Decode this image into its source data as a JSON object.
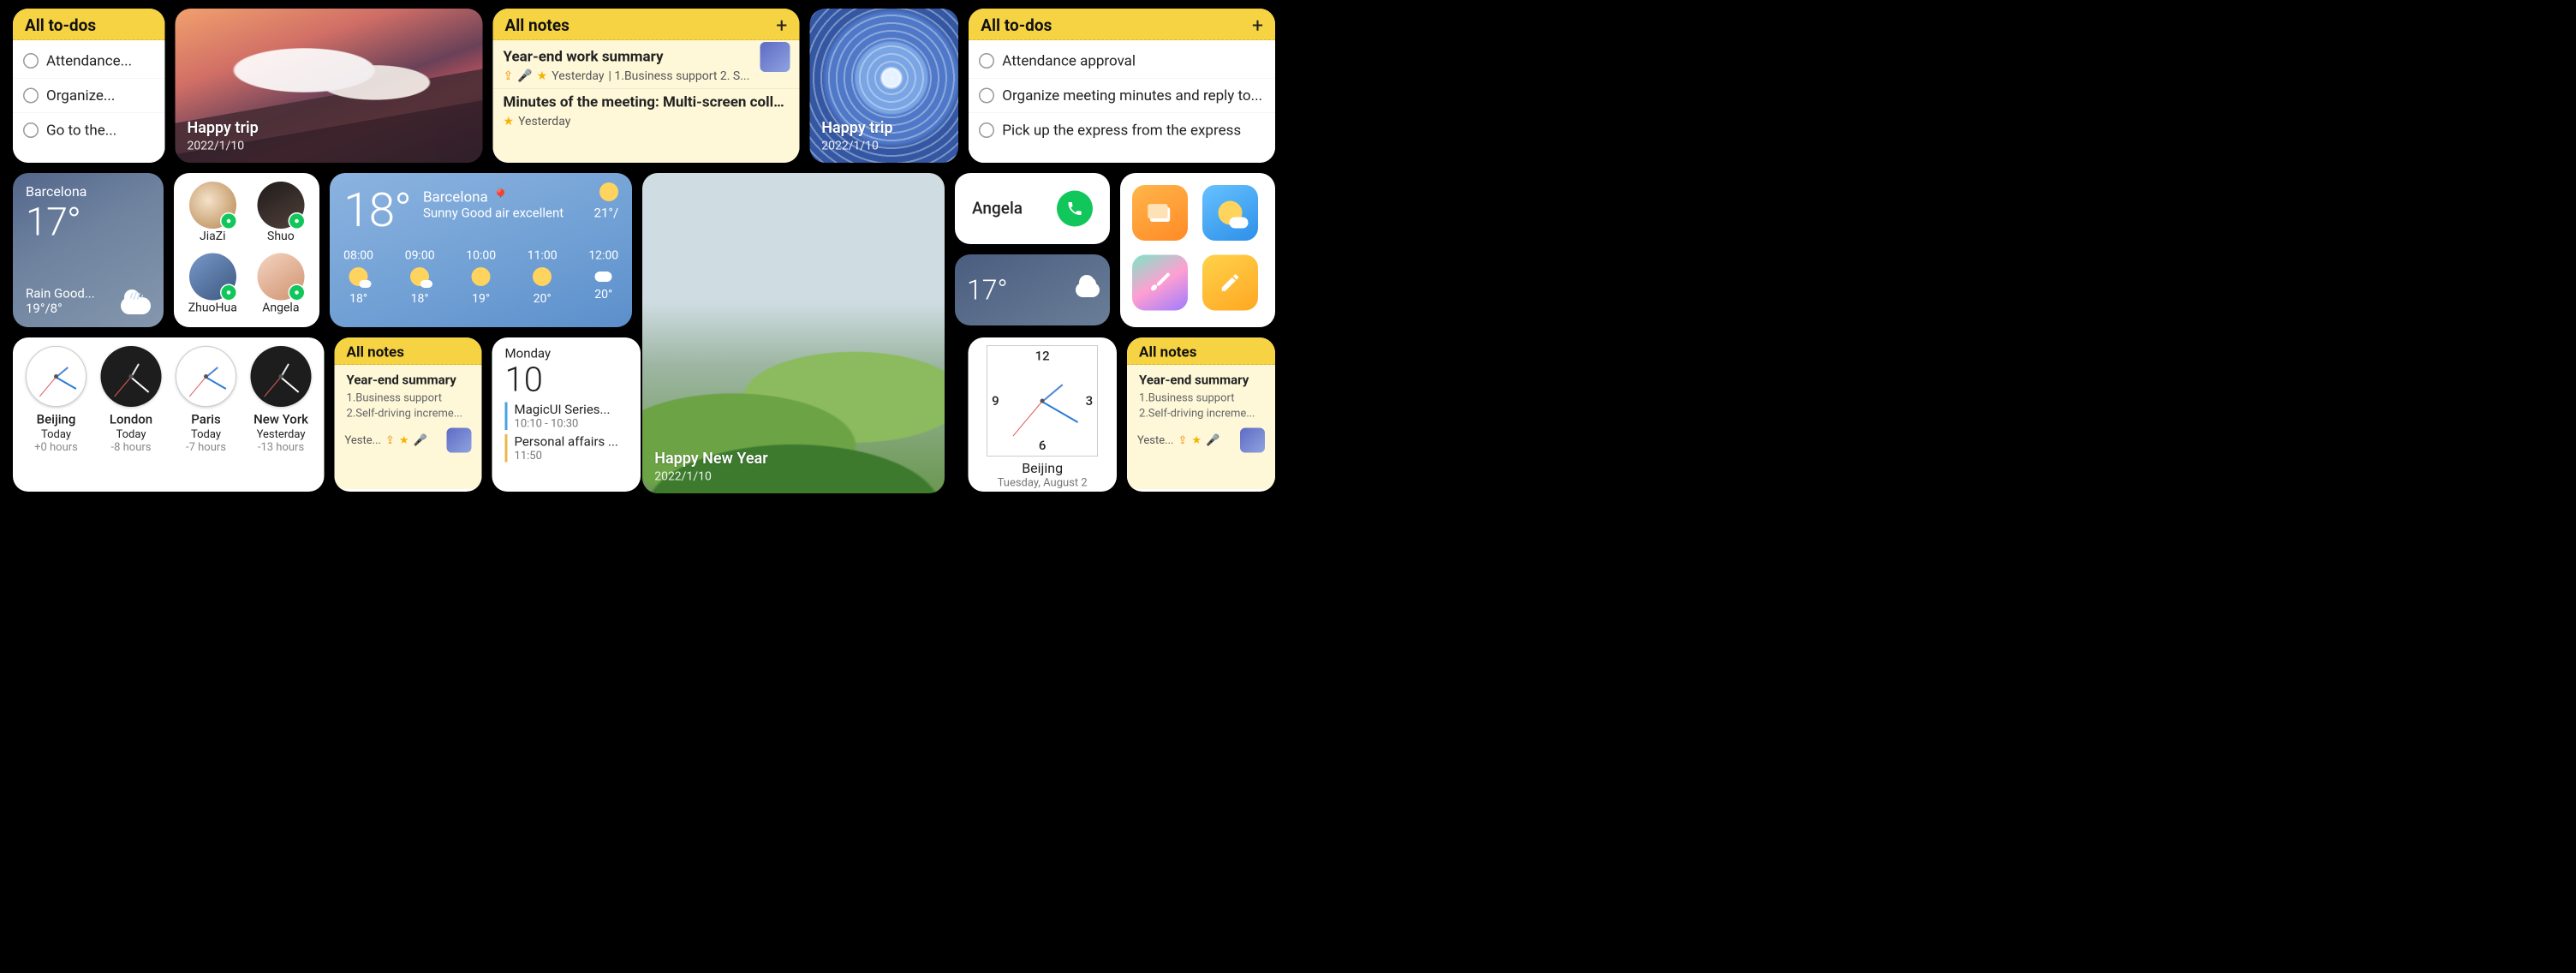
{
  "row1": {
    "todos_small": {
      "title": "All to-dos",
      "items": [
        "Attendance...",
        "Organize...",
        "Go to the..."
      ]
    },
    "trip_photo": {
      "title": "Happy trip",
      "date": "2022/1/10"
    },
    "all_notes_wide": {
      "title": "All notes",
      "item1": {
        "title": "Year-end work summary",
        "sub_prefix_top": "⇪",
        "sub_prefix_mic": "🎤",
        "sub_date": "Yesterday",
        "sub_rest": "| 1.Business support  2. S..."
      },
      "item2": {
        "title": "Minutes of the meeting: Multi-screen collabor...",
        "sub_date": "Yesterday"
      }
    },
    "swirl_photo": {
      "title": "Happy trip",
      "date": "2022/1/10"
    },
    "todos_wide": {
      "title": "All to-dos",
      "items": [
        "Attendance approval",
        "Organize meeting minutes and reply to...",
        "Pick up the express from the express"
      ]
    }
  },
  "row2": {
    "weather_small": {
      "city": "Barcelona",
      "temp": "17°",
      "cond": "Rain  Good...",
      "range": "19°/8°"
    },
    "contacts": [
      {
        "name": "JiaZi"
      },
      {
        "name": "Shuo"
      },
      {
        "name": "ZhuoHua"
      },
      {
        "name": "Angela"
      }
    ],
    "weather_wide": {
      "temp": "18°",
      "city": "Barcelona",
      "line": "Sunny  Good air excellent",
      "right_range": "21°/",
      "hours": [
        {
          "t": "08:00",
          "temp": "18°",
          "ico": "partly"
        },
        {
          "t": "09:00",
          "temp": "18°",
          "ico": "partly"
        },
        {
          "t": "10:00",
          "temp": "19°",
          "ico": "sun"
        },
        {
          "t": "11:00",
          "temp": "20°",
          "ico": "sun"
        },
        {
          "t": "12:00",
          "temp": "20°",
          "ico": "cloud"
        }
      ]
    },
    "call": {
      "name": "Angela"
    },
    "mini_temp": "17°"
  },
  "row3": {
    "clocks": [
      {
        "city": "Beijing",
        "day": "Today",
        "off": "+0 hours",
        "style": "light"
      },
      {
        "city": "London",
        "day": "Today",
        "off": "-8 hours",
        "style": "dark"
      },
      {
        "city": "Paris",
        "day": "Today",
        "off": "-7 hours",
        "style": "light"
      },
      {
        "city": "New York",
        "day": "Yesterday",
        "off": "-13 hours",
        "style": "dark"
      }
    ],
    "notes_small": {
      "title": "All notes",
      "item_title": "Year-end summary",
      "line1": "1.Business  support",
      "line2": "2.Self-driving increme...",
      "foot": "Yeste..."
    },
    "calendar": {
      "dow": "Monday",
      "dnum": "10",
      "ev1_t": "MagicUI Series...",
      "ev1_tm": "10:10 - 10:30",
      "ev2_t": "Personal affairs ...",
      "ev2_tm": "11:50"
    },
    "hills_photo": {
      "title": "Happy New Year",
      "date": "2022/1/10"
    },
    "bigclock": {
      "city": "Beijing",
      "sub": "Tuesday, August 2"
    },
    "notes_small2": {
      "title": "All notes",
      "item_title": "Year-end summary",
      "line1": "1.Business  support",
      "line2": "2.Self-driving increme...",
      "foot": "Yeste..."
    }
  }
}
